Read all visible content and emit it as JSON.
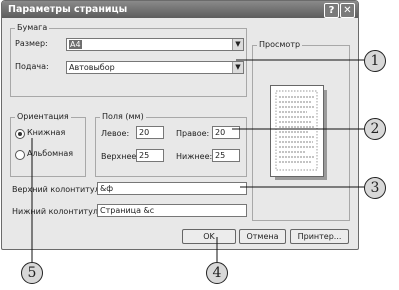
{
  "window": {
    "title": "Параметры страницы"
  },
  "paper": {
    "group_label": "Бумага",
    "size_label": "Размер:",
    "size_value": "A4",
    "source_label": "Подача:",
    "source_value": "Автовыбор"
  },
  "orientation": {
    "group_label": "Ориентация",
    "portrait_label": "Книжная",
    "landscape_label": "Альбомная",
    "selected": "portrait"
  },
  "margins": {
    "group_label": "Поля (мм)",
    "left_label": "Левое:",
    "left_value": "20",
    "right_label": "Правое:",
    "right_value": "20",
    "top_label": "Верхнее:",
    "top_value": "25",
    "bottom_label": "Нижнее:",
    "bottom_value": "25"
  },
  "preview": {
    "group_label": "Просмотр"
  },
  "header": {
    "label": "Верхний колонтитул:",
    "value": "&ф"
  },
  "footer": {
    "label": "Нижний колонтитул:",
    "value": "Страница &с"
  },
  "buttons": {
    "ok": "OK",
    "cancel": "Отмена",
    "printer": "Принтер..."
  },
  "callouts": [
    "1",
    "2",
    "3",
    "4",
    "5"
  ]
}
